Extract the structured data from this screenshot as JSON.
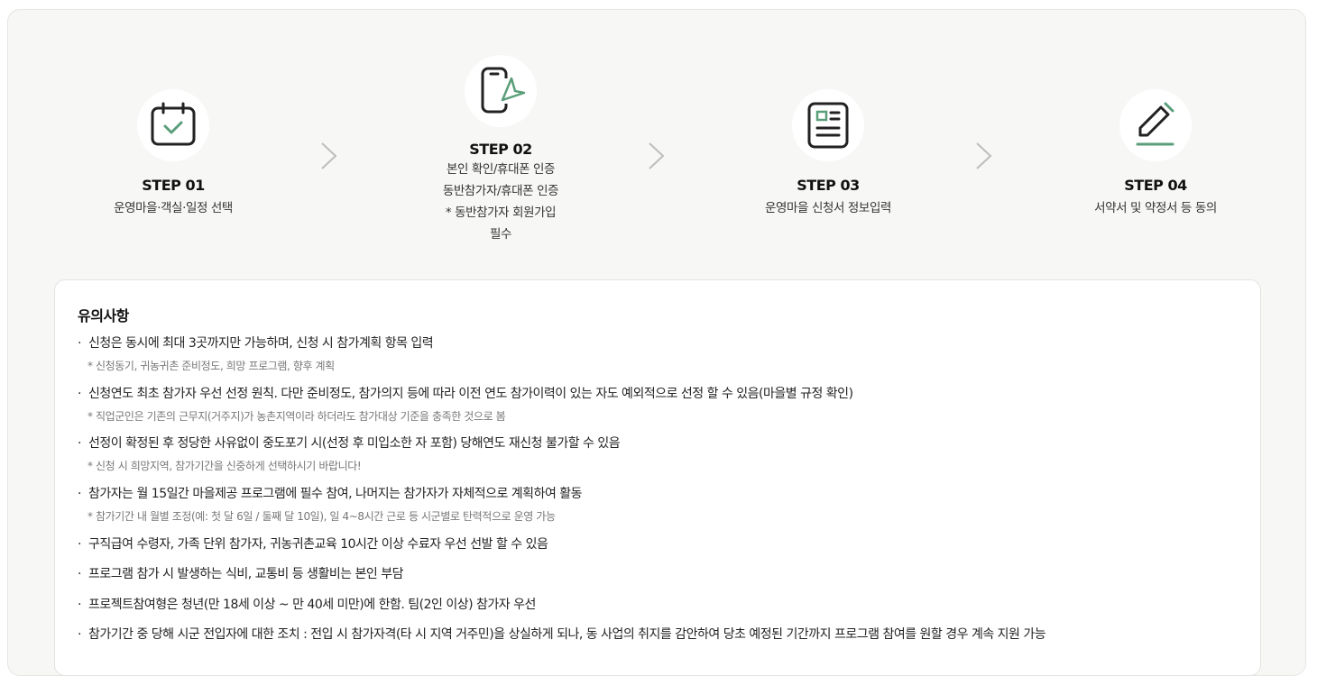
{
  "steps": [
    {
      "title": "STEP 01",
      "icon": "calendar-check-icon",
      "lines": [
        "운영마을·객실·일정 선택"
      ]
    },
    {
      "title": "STEP 02",
      "icon": "phone-send-icon",
      "lines": [
        "본인 확인/휴대폰 인증",
        "동반참가자/휴대폰 인증",
        "* 동반참가자 회원가입",
        "필수"
      ]
    },
    {
      "title": "STEP 03",
      "icon": "document-icon",
      "lines": [
        "운영마을 신청서 정보입력"
      ]
    },
    {
      "title": "STEP 04",
      "icon": "pen-icon",
      "lines": [
        "서약서 및 약정서 등 동의"
      ]
    }
  ],
  "notice": {
    "title": "유의사항",
    "bullet": "·",
    "items": [
      {
        "text": "신청은 동시에 최대 3곳까지만 가능하며, 신청 시 참가계획 항목 입력",
        "sub": "* 신청동기, 귀농귀촌 준비정도, 희망 프로그램, 향후 계획"
      },
      {
        "text": "신청연도 최초 참가자 우선 선정 원칙. 다만 준비정도, 참가의지 등에 따라 이전 연도 참가이력이 있는 자도 예외적으로 선정 할 수 있음(마을별 규정 확인)",
        "sub": "* 직업군인은 기존의 근무지(거주지)가 농촌지역이라 하더라도 참가대상 기준을 충족한 것으로 봄"
      },
      {
        "text": "선정이 확정된 후 정당한 사유없이 중도포기 시(선정 후 미입소한 자 포함) 당해연도 재신청 불가할 수 있음",
        "sub": "* 신청 시 희망지역, 참가기간을 신중하게 선택하시기 바랍니다!"
      },
      {
        "text": "참가자는 월 15일간 마을제공 프로그램에 필수 참여, 나머지는 참가자가 자체적으로 계획하여 활동",
        "sub": "* 참가기간 내 월별 조정(예: 첫 달 6일 / 둘째 달 10일), 일 4~8시간 근로 등 시군별로 탄력적으로 운영 가능"
      },
      {
        "text": "구직급여 수령자, 가족 단위 참가자, 귀농귀촌교육 10시간 이상 수료자 우선 선발 할 수 있음"
      },
      {
        "text": "프로그램 참가 시 발생하는 식비, 교통비 등 생활비는 본인 부담"
      },
      {
        "text": "프로젝트참여형은 청년(만 18세 이상 ~ 만 40세 미만)에 한함. 팀(2인 이상) 참가자 우선"
      },
      {
        "text": "참가기간 중 당해 시군 전입자에 대한 조치 : 전입 시 참가자격(타 시 지역 거주민)을 상실하게 되나, 동 사업의 취지를 감안하여 당초 예정된 기간까지 프로그램 참여를 원할 경우 계속 지원 가능"
      }
    ]
  },
  "colors": {
    "accent": "#5a9e7a",
    "icon_stroke": "#222222"
  }
}
